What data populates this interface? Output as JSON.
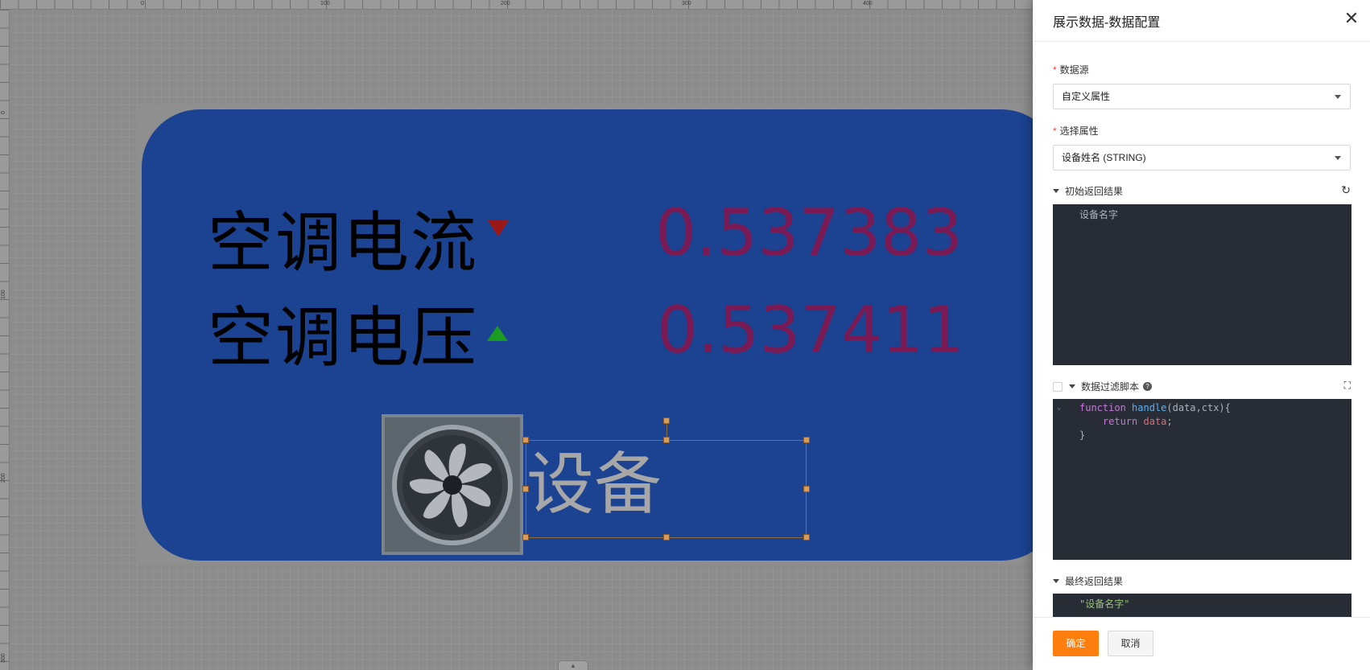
{
  "canvas": {
    "ruler_top_labels": [
      "0",
      "100",
      "200",
      "300",
      "400"
    ],
    "ruler_left_labels": [
      "0",
      "100",
      "200",
      "300"
    ],
    "rows": [
      {
        "label": "空调电流",
        "value": "0.537383",
        "trend": "down"
      },
      {
        "label": "空调电压",
        "value": "0.537411",
        "trend": "up"
      }
    ],
    "device_text": "设备",
    "fan_icon": "fan-icon",
    "colors": {
      "panel": "#1b4391",
      "value": "#7a1a55",
      "trend_down": "#9c1717",
      "trend_up": "#1a9c22"
    }
  },
  "drawer": {
    "title": "展示数据-数据配置",
    "close_icon": "close-icon",
    "data_source": {
      "label": "数据源",
      "required": "*",
      "value": "自定义属性"
    },
    "property": {
      "label": "选择属性",
      "required": "*",
      "value": "设备姓名 (STRING)"
    },
    "initial_result": {
      "title": "初始返回结果",
      "content": "设备名字",
      "refresh_icon": "refresh-icon"
    },
    "filter_script": {
      "title": "数据过滤脚本",
      "help_icon": "question-icon",
      "expand_icon": "fullscreen-icon",
      "code": {
        "kw_function": "function",
        "fn_name": "handle",
        "params": "(data,ctx){",
        "kw_return": "return",
        "ret_var": "data",
        "semicolon": ";",
        "close_brace": "}"
      }
    },
    "final_result": {
      "title": "最终返回结果",
      "content": "\"设备名字\""
    },
    "buttons": {
      "ok": "确定",
      "cancel": "取消"
    },
    "accent_color": "#ff7e0e"
  }
}
